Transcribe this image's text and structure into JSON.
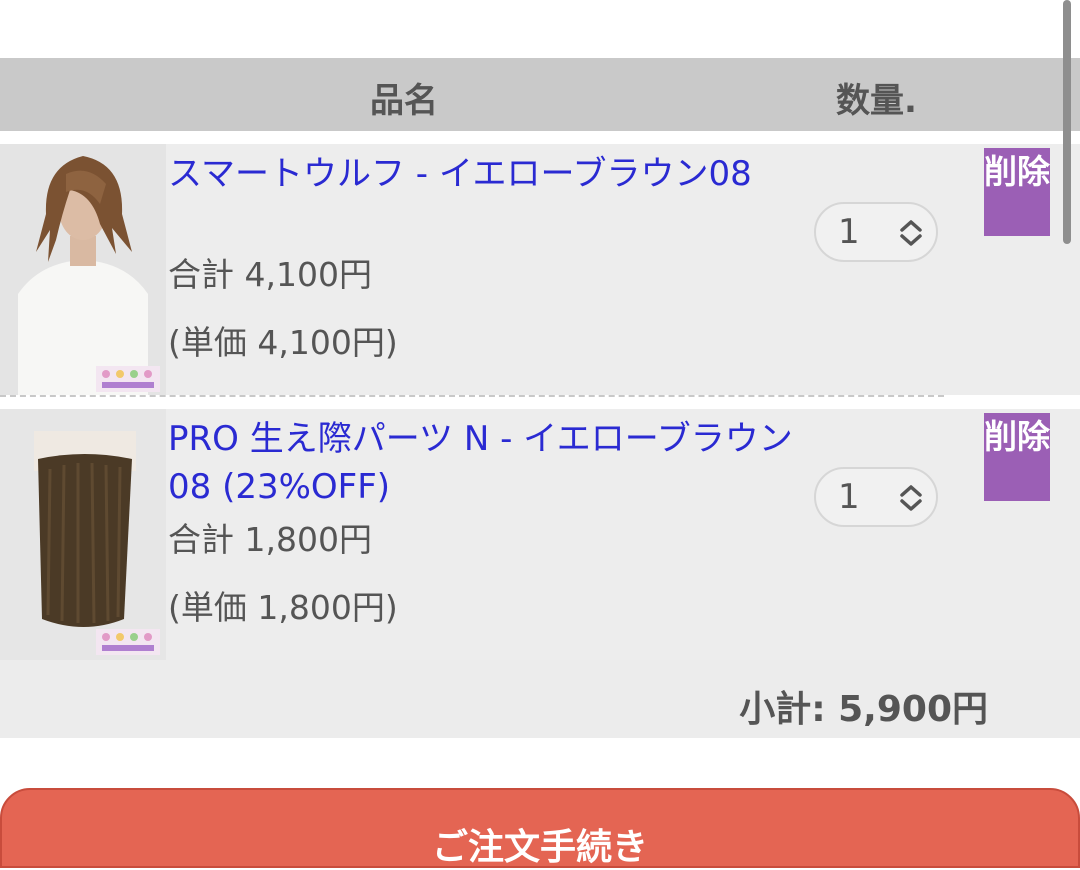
{
  "table_header": {
    "name": "品名",
    "quantity": "数量."
  },
  "items": [
    {
      "title": "スマートウルフ - イエローブラウン08",
      "total": "合計 4,100円",
      "unit_price": "(単価 4,100円)",
      "quantity": "1",
      "delete_label": "削除"
    },
    {
      "title": "PRO 生え際パーツ N - イエローブラウン08 (23%OFF)",
      "total": "合計 1,800円",
      "unit_price": "(単価 1,800円)",
      "quantity": "1",
      "delete_label": "削除"
    }
  ],
  "subtotal": "小計: 5,900円",
  "order_button": "ご注文手続き",
  "colors": {
    "link": "#2a2ad2",
    "delete_bg": "#9b5fb5",
    "order_bg": "#e46553",
    "header_bg": "#c9c9c9"
  }
}
